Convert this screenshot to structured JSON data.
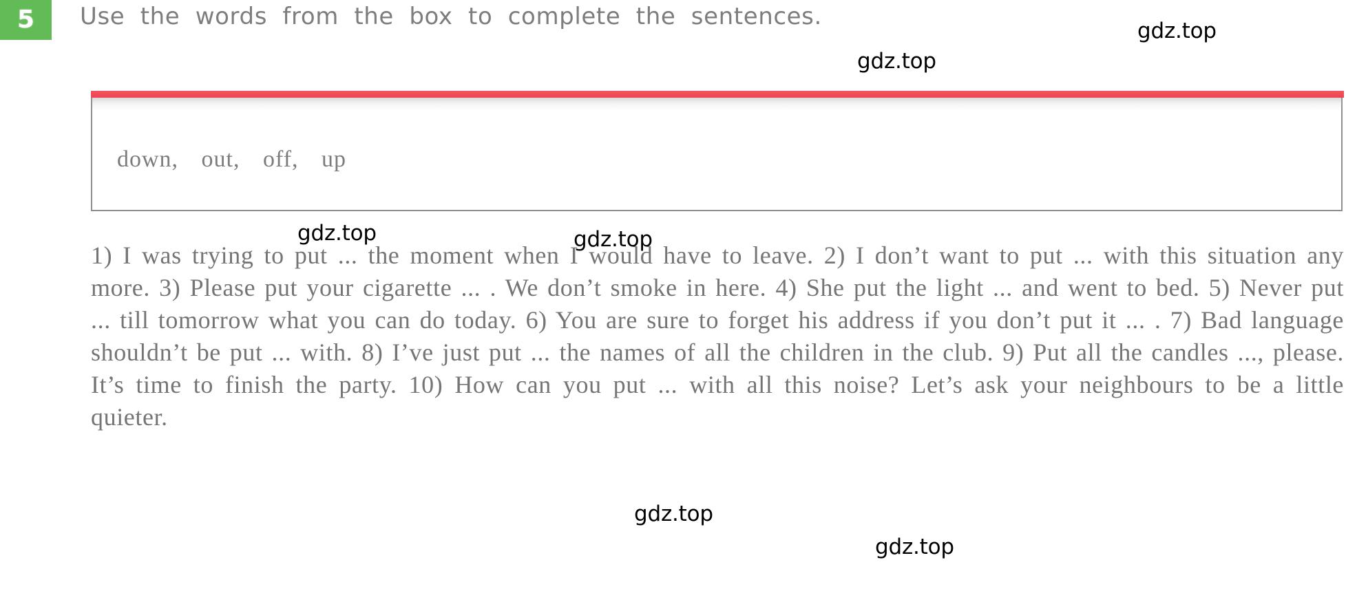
{
  "exercise": {
    "number": "5",
    "badge_color": "#63bb57",
    "heading": "Use the words from the box to complete the sentences."
  },
  "word_box": {
    "accent_color": "#f4505c",
    "border_color": "#909090",
    "words": "down,    out,    off,    up"
  },
  "body": {
    "text": "1) I was trying to put ... the moment when I would have to leave. 2) I don’t want to put ... with this situation any more. 3) Please put your cigarette ... . We don’t smoke in here. 4) She put the light ... and went to bed. 5) Never put ... till tomorrow what you can do today. 6) You are sure to forget his address if you don’t put it ... . 7) Bad language shouldn’t be put ... with. 8) I’ve just put ... the names of all the chil­dren in the club. 9) Put all the candles ..., please. It’s time to finish the party. 10) How can you put ... with all this noise? Let’s ask your neighbours to be a little quieter."
  },
  "watermarks": {
    "label": "gdz.top",
    "items": [
      {
        "text": "gdz.top"
      },
      {
        "text": "gdz.top"
      },
      {
        "text": "gdz.top"
      },
      {
        "text": "gdz.top"
      },
      {
        "text": "gdz.top"
      },
      {
        "text": "gdz.top"
      }
    ]
  }
}
